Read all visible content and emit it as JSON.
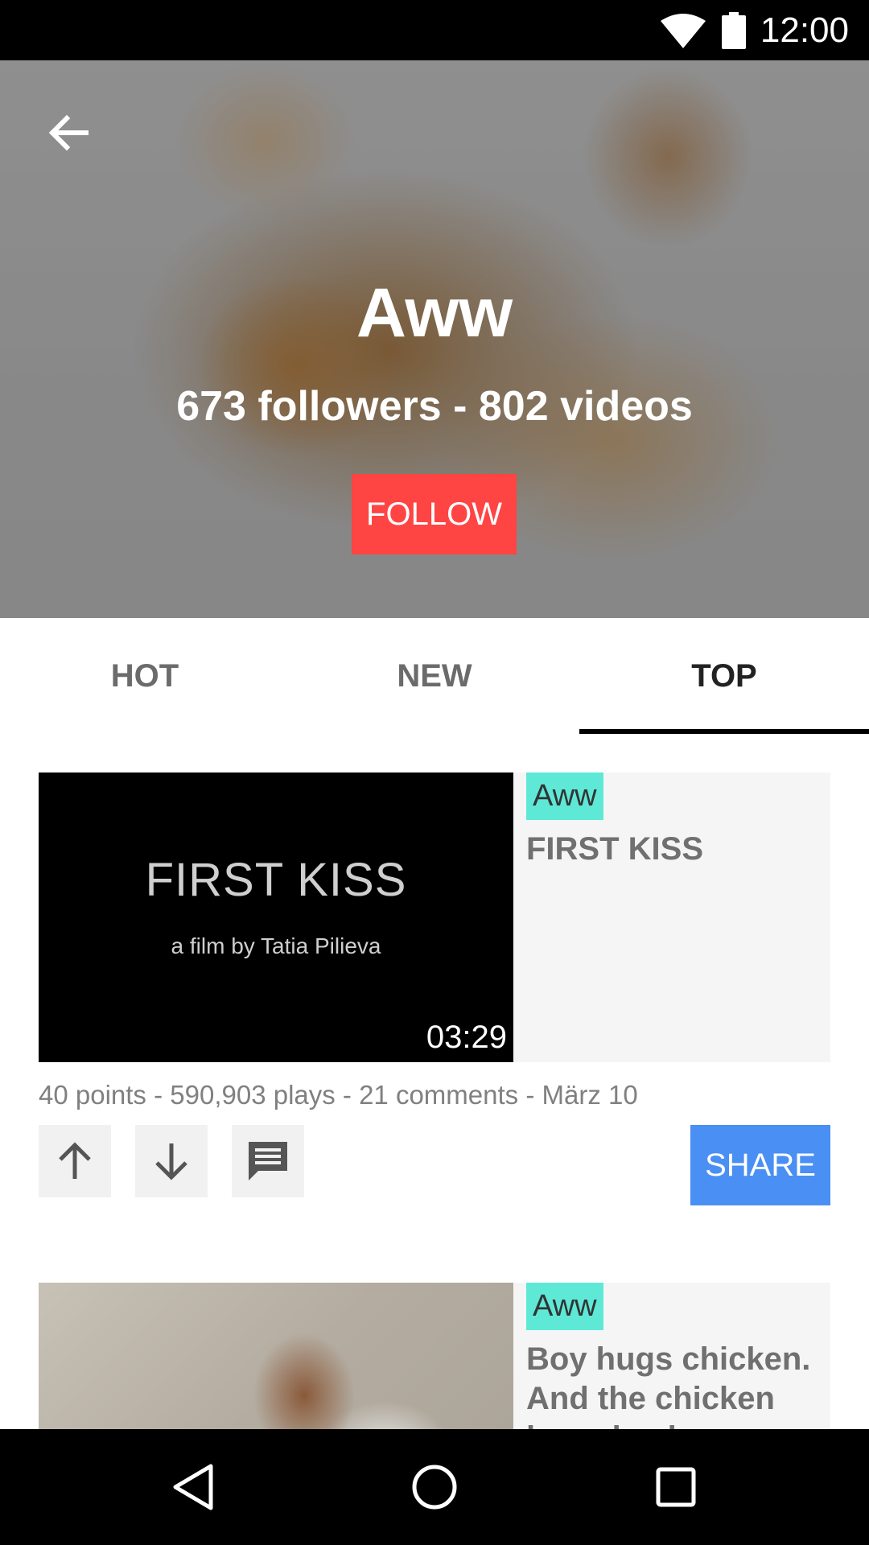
{
  "status_bar": {
    "time": "12:00",
    "icons": [
      "wifi-icon",
      "battery-icon"
    ]
  },
  "header": {
    "back_icon": "arrow-back-icon",
    "title": "Aww",
    "subtitle": "673 followers - 802 videos",
    "follow_label": "FOLLOW"
  },
  "tabs": [
    {
      "label": "HOT",
      "active": false
    },
    {
      "label": "NEW",
      "active": false
    },
    {
      "label": "TOP",
      "active": true
    }
  ],
  "videos": [
    {
      "tag": "Aww",
      "title": "FIRST KISS",
      "thumbnail_title": "FIRST KISS",
      "thumbnail_credit": "a film by Tatia Pilieva",
      "duration": "03:29",
      "meta": "40 points - 590,903 plays - 21 comments - März 10",
      "share_label": "SHARE",
      "action_icons": [
        "arrow-up-icon",
        "arrow-down-icon",
        "comment-icon"
      ]
    },
    {
      "tag": "Aww",
      "title": "Boy hugs chicken. And the chicken hugs back"
    }
  ],
  "colors": {
    "follow": "#ff4444",
    "share": "#4a8ff3",
    "tag": "#5ee9d7",
    "tab_indicator": "#000000"
  },
  "nav_bar": {
    "icons": [
      "back-triangle-icon",
      "home-circle-icon",
      "recents-square-icon"
    ]
  }
}
